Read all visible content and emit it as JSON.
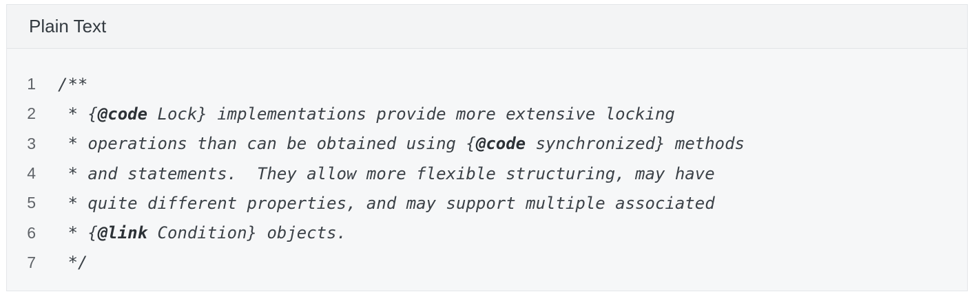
{
  "header": {
    "language_label": "Plain Text"
  },
  "code": {
    "lines": [
      {
        "num": "1",
        "parts": [
          {
            "text": "/**",
            "bold": false
          }
        ]
      },
      {
        "num": "2",
        "parts": [
          {
            "text": " * {",
            "bold": false
          },
          {
            "text": "@code",
            "bold": true
          },
          {
            "text": " Lock} implementations provide more extensive locking",
            "bold": false
          }
        ]
      },
      {
        "num": "3",
        "parts": [
          {
            "text": " * operations than can be obtained using {",
            "bold": false
          },
          {
            "text": "@code",
            "bold": true
          },
          {
            "text": " synchronized} methods",
            "bold": false
          }
        ]
      },
      {
        "num": "4",
        "parts": [
          {
            "text": " * and statements.  They allow more flexible structuring, may have",
            "bold": false
          }
        ]
      },
      {
        "num": "5",
        "parts": [
          {
            "text": " * quite different properties, and may support multiple associated",
            "bold": false
          }
        ]
      },
      {
        "num": "6",
        "parts": [
          {
            "text": " * {",
            "bold": false
          },
          {
            "text": "@link",
            "bold": true
          },
          {
            "text": " Condition} objects.",
            "bold": false
          }
        ]
      },
      {
        "num": "7",
        "parts": [
          {
            "text": " */",
            "bold": false
          }
        ]
      }
    ]
  }
}
